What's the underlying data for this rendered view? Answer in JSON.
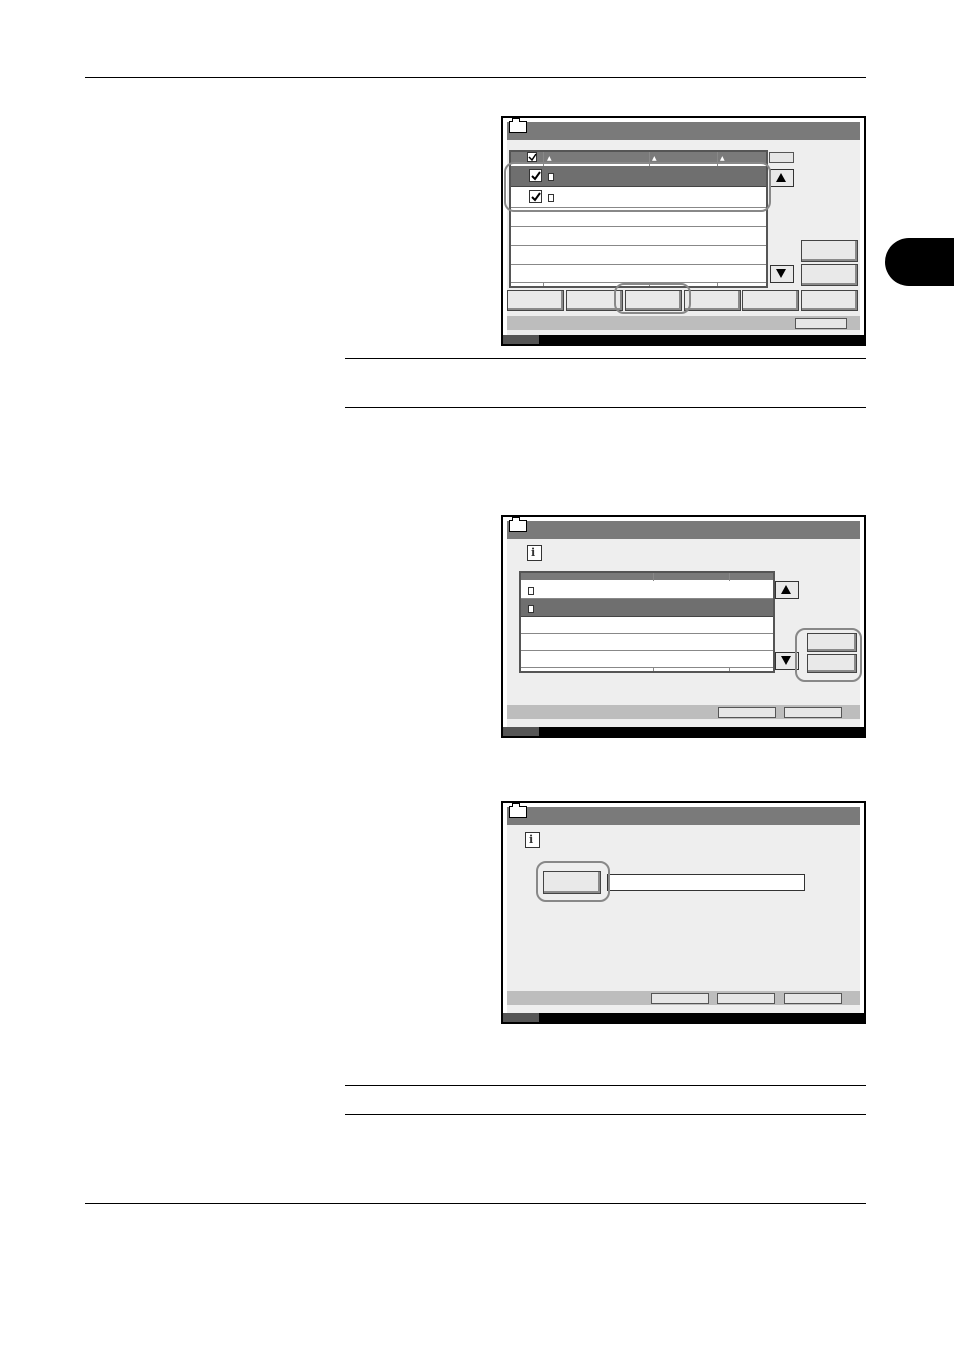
{
  "page": {
    "text": []
  },
  "screens": {
    "document_list": {
      "title": "",
      "table_headers": [
        "",
        "",
        ""
      ],
      "rows": [
        {
          "checked": true,
          "selected": true
        },
        {
          "checked": true,
          "selected": false
        },
        {
          "checked": false,
          "selected": false
        },
        {
          "checked": false,
          "selected": false
        },
        {
          "checked": false,
          "selected": false
        },
        {
          "checked": false,
          "selected": false
        }
      ],
      "icons": [
        "folder-icon",
        "checkbox-icon",
        "document-icon",
        "arrow-up-icon",
        "arrow-down-icon"
      ]
    },
    "order_dialog": {
      "title": "",
      "icons": [
        "folder-icon",
        "info-icon",
        "document-icon",
        "arrow-up-icon",
        "arrow-down-icon"
      ]
    },
    "name_dialog": {
      "title": "",
      "field_value": "",
      "icons": [
        "folder-icon",
        "info-icon"
      ]
    }
  },
  "colors": {
    "titlebar": "#7a7a7a",
    "selected_row": "#6f6f6f",
    "callout": "#888888",
    "panel": "#eeeeee"
  }
}
